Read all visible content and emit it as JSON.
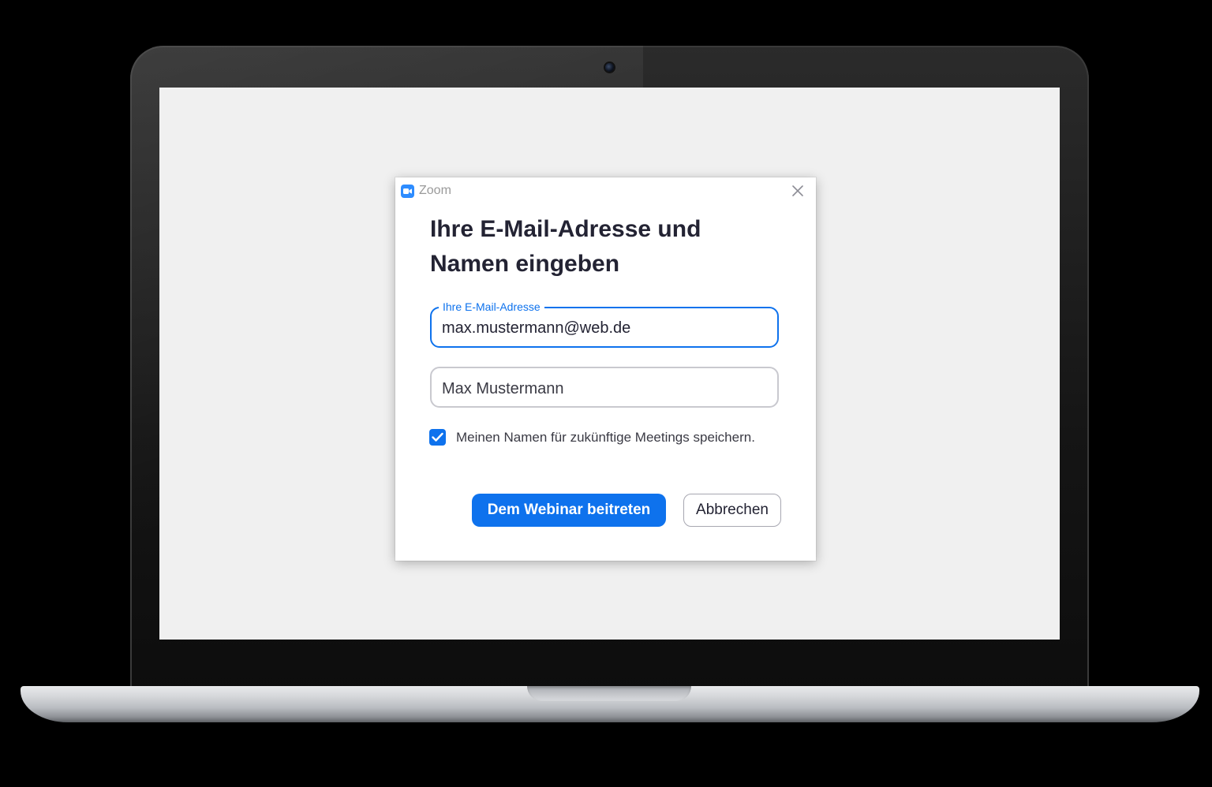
{
  "window": {
    "title": "Zoom",
    "logo_icon": "zoom-video-camera-icon",
    "close_icon": "close-icon"
  },
  "dialog": {
    "heading": "Ihre E-Mail-Adresse und Namen eingeben",
    "email_field": {
      "label": "Ihre E-Mail-Adresse",
      "value": "max.mustermann@web.de"
    },
    "name_field": {
      "value": "Max Mustermann"
    },
    "remember_checkbox": {
      "label": "Meinen Namen für zukünftige Meetings speichern.",
      "checked": true
    },
    "join_button_label": "Dem Webinar beitreten",
    "cancel_button_label": "Abbrechen"
  },
  "colors": {
    "accent": "#0e72ed",
    "logo": "#2d8cff",
    "heading_text": "#232333",
    "screen_background": "#f0f0f0"
  }
}
